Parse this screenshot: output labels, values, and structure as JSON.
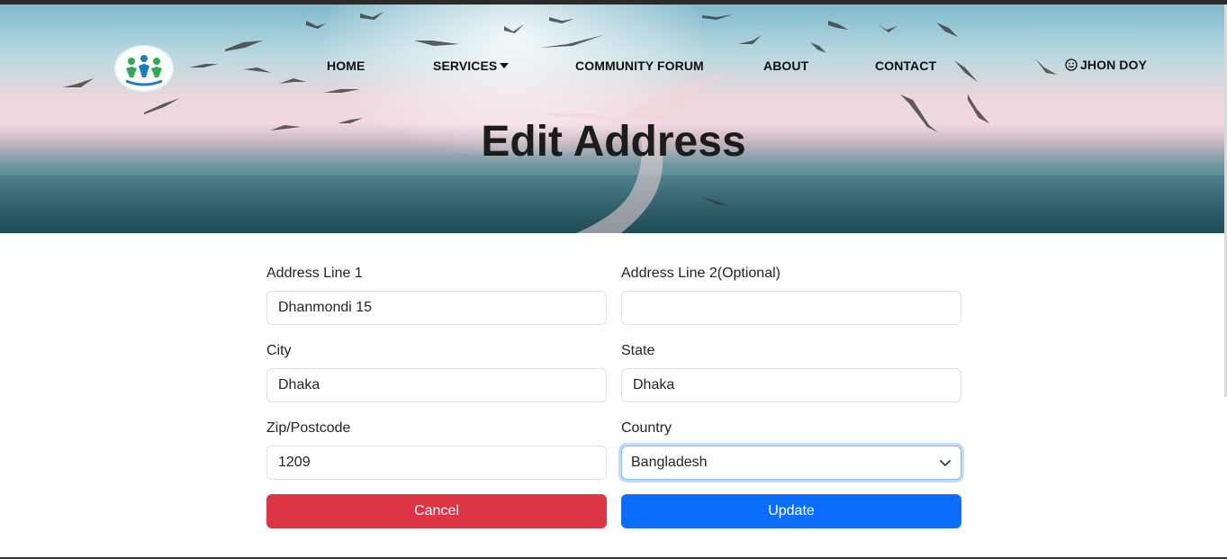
{
  "nav": {
    "home": "HOME",
    "services": "SERVICES",
    "forum": "COMMUNITY FORUM",
    "about": "ABOUT",
    "contact": "CONTACT",
    "user": "JHON DOY",
    "services_icon": "caret-down-icon",
    "user_icon": "smiley-icon"
  },
  "hero": {
    "title": "Edit Address"
  },
  "form": {
    "address1": {
      "label": "Address Line 1",
      "value": "Dhanmondi 15"
    },
    "address2": {
      "label": "Address Line 2(Optional)",
      "value": ""
    },
    "city": {
      "label": "City",
      "value": "Dhaka"
    },
    "state": {
      "label": "State",
      "value": "Dhaka"
    },
    "zip": {
      "label": "Zip/Postcode",
      "value": "1209"
    },
    "country": {
      "label": "Country",
      "value": "Bangladesh"
    },
    "cancel_label": "Cancel",
    "update_label": "Update"
  },
  "colors": {
    "cancel": "#dc3545",
    "update": "#0d6efd",
    "focus_ring": "#86b7fe"
  }
}
